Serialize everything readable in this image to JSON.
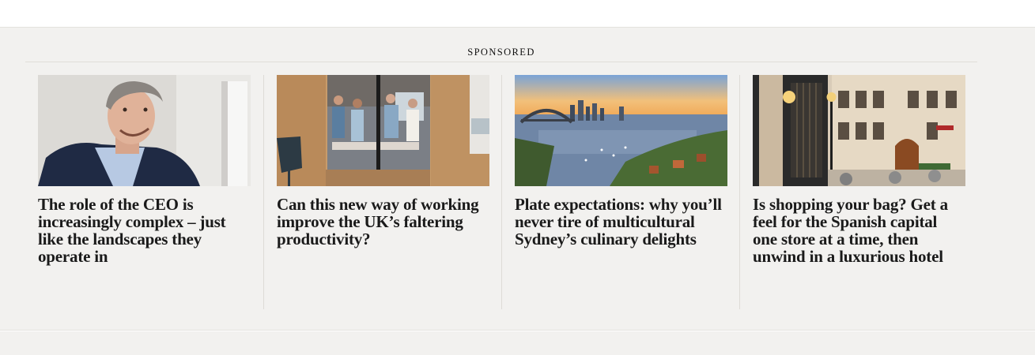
{
  "section": {
    "label": "SPONSORED"
  },
  "cards": [
    {
      "headline": "The role of the CEO is increasingly complex – just like the landscapes they operate in",
      "image_icon": "ceo-portrait-image"
    },
    {
      "headline": "Can this new way of working improve the UK’s faltering productivity?",
      "image_icon": "office-meeting-image"
    },
    {
      "headline": "Plate expectations: why you’ll never tire of multicultural Sydney’s culinary delights",
      "image_icon": "sydney-harbour-image"
    },
    {
      "headline": "Is shopping your bag? Get a feel for the Spanish capital one store at a time, then unwind in a luxurious hotel",
      "image_icon": "madrid-street-image"
    }
  ]
}
